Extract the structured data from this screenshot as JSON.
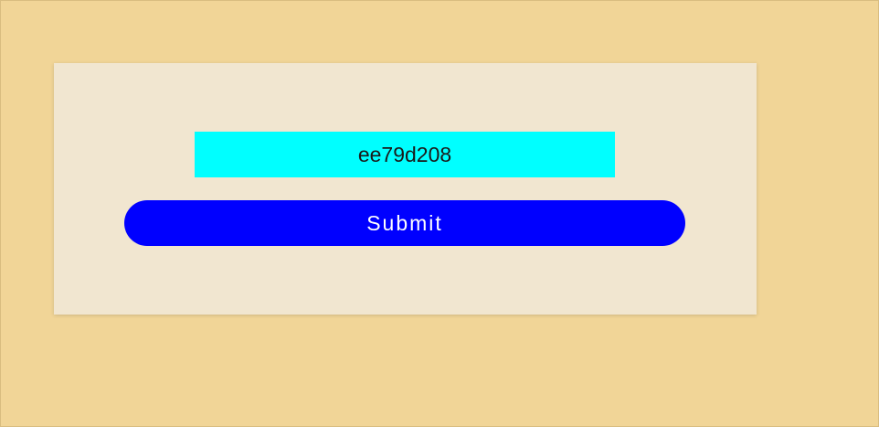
{
  "form": {
    "code_value": "ee79d208",
    "submit_label": "Submit"
  },
  "colors": {
    "page_background": "#f1d597",
    "card_background": "#f1e6d0",
    "field_background": "#00ffff",
    "button_background": "#0000ff",
    "button_text": "#ffffff"
  }
}
